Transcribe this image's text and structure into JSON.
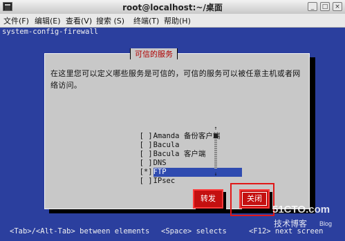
{
  "window": {
    "title": "root@localhost:~/桌面",
    "buttons": [
      "_",
      "□",
      "×"
    ]
  },
  "menubar": {
    "items": [
      "文件(F)",
      "编辑(E)",
      "查看(V)",
      "搜索 (S)",
      "终端(T)",
      "帮助(H)"
    ]
  },
  "terminal": {
    "header": "system-config-firewall",
    "footer": {
      "left": "<Tab>/<Alt-Tab> between elements",
      "middle": "<Space> selects",
      "right": "<F12> next screen"
    }
  },
  "dialog": {
    "title": "可信的服务",
    "description": "在这里您可以定义哪些服务是可信的，可信的服务可以被任意主机或者网络访问。",
    "services": [
      {
        "check": "[ ]",
        "name": "Amanda 备份客户端",
        "checked": false
      },
      {
        "check": "[ ]",
        "name": "Bacula",
        "checked": false
      },
      {
        "check": "[ ]",
        "name": "Bacula 客户端",
        "checked": false
      },
      {
        "check": "[ ]",
        "name": "DNS",
        "checked": false
      },
      {
        "check": "[*]",
        "name": "FTP",
        "checked": true
      },
      {
        "check": "[ ]",
        "name": "IPsec",
        "checked": false
      }
    ],
    "scroll_up": "↑",
    "scroll_down": "↓",
    "ok_label": "转发",
    "close_label": "关闭"
  },
  "watermark": {
    "logo": "51CTO.com",
    "sub": "技术博客",
    "blog": "Blog"
  }
}
